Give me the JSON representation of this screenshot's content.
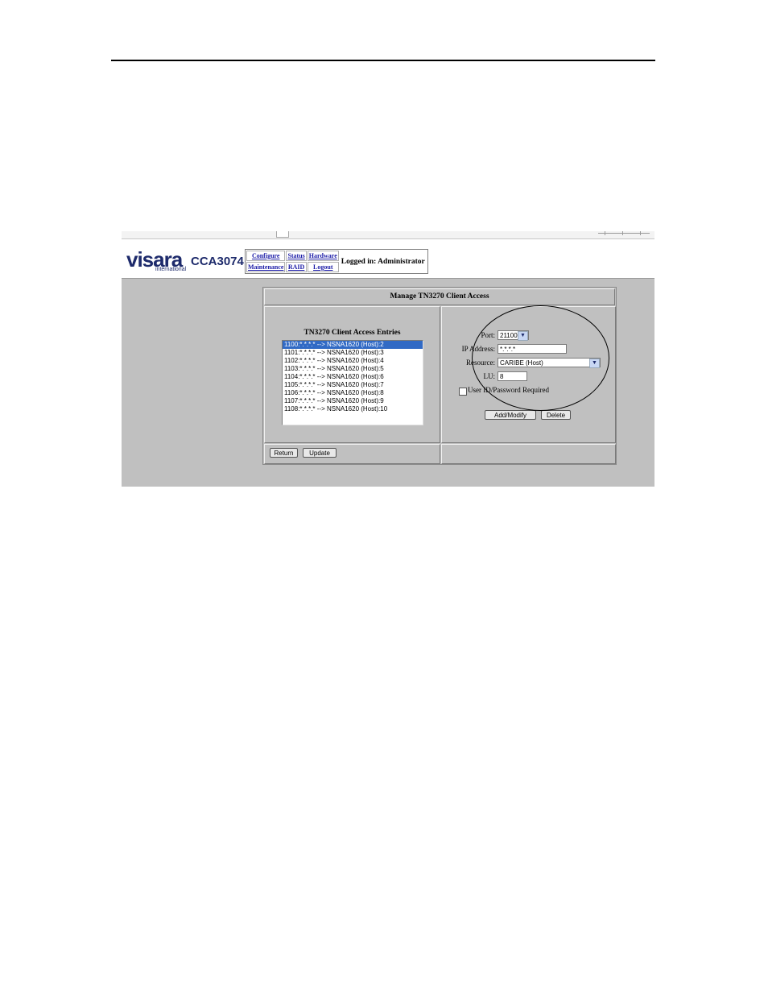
{
  "header": {
    "logo_text": "visara",
    "logo_sub": "international",
    "model": "CCA3074",
    "nav": {
      "configure": "Configure",
      "status": "Status",
      "hardware": "Hardware",
      "maintenance": "Maintenance",
      "raid": "RAID",
      "logout": "Logout"
    },
    "logged_in": "Logged in: Administrator"
  },
  "panel": {
    "title": "Manage TN3270 Client Access",
    "list_title": "TN3270 Client Access Entries",
    "entries": [
      "1100:*.*.*.* --> NSNA1620 (Host):2",
      "1101:*.*.*.* --> NSNA1620 (Host):3",
      "1102:*.*.*.* --> NSNA1620 (Host):4",
      "1103:*.*.*.* --> NSNA1620 (Host):5",
      "1104:*.*.*.* --> NSNA1620 (Host):6",
      "1105:*.*.*.* --> NSNA1620 (Host):7",
      "1106:*.*.*.* --> NSNA1620 (Host):8",
      "1107:*.*.*.* --> NSNA1620 (Host):9",
      "1108:*.*.*.* --> NSNA1620 (Host):10"
    ],
    "selected_index": 0,
    "form": {
      "port_label": "Port:",
      "port_value": "21100",
      "ip_label": "IP Address:",
      "ip_value": "*.*.*.*",
      "resource_label": "Resource:",
      "resource_value": "CARIBE (Host)",
      "lu_label": "LU:",
      "lu_value": "8",
      "userid_label": "User ID/Password Required",
      "userid_checked": false
    },
    "buttons": {
      "add_modify": "Add/Modify",
      "delete": "Delete",
      "return": "Return",
      "update": "Update"
    }
  }
}
